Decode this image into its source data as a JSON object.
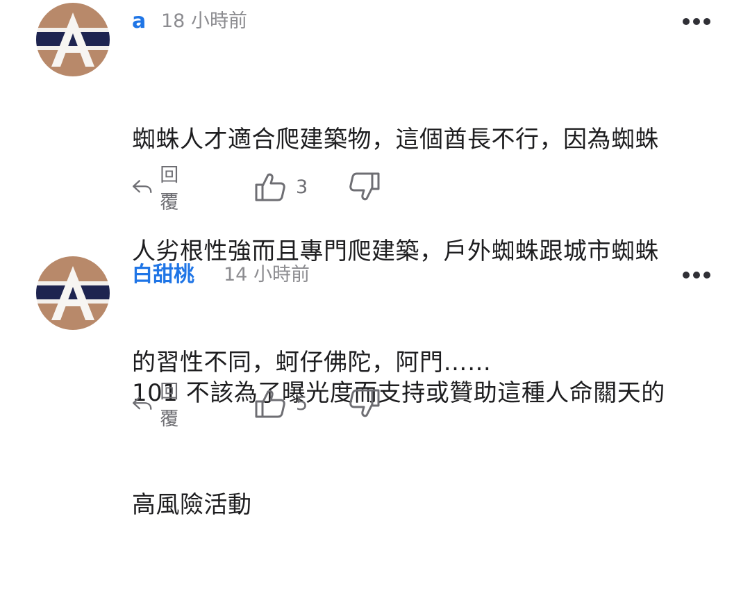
{
  "comments": [
    {
      "username": "a",
      "timestamp": "18 小時前",
      "lines": [
        "蜘蛛人才適合爬建築物，這個酋長不行，因為蜘蛛",
        "人劣根性強而且專門爬建築，戶外蜘蛛跟城市蜘蛛",
        "的習性不同，蚵仔佛陀，阿門……"
      ],
      "reply_label": "回覆",
      "like_count": "3",
      "avatar_letter": "A",
      "more_icon": "more-horizontal-icon",
      "reply_icon": "reply-arrow-icon",
      "like_icon": "thumbs-up-icon",
      "dislike_icon": "thumbs-down-icon"
    },
    {
      "username": "白甜桃",
      "timestamp": "14 小時前",
      "lines": [
        "101 不該為了曝光度而支持或贊助這種人命關天的",
        "高風險活動"
      ],
      "reply_label": "回覆",
      "like_count": "5",
      "avatar_letter": "A",
      "more_icon": "more-horizontal-icon",
      "reply_icon": "reply-arrow-icon",
      "like_icon": "thumbs-up-icon",
      "dislike_icon": "thumbs-down-icon"
    }
  ],
  "colors": {
    "username": "#1f75e6",
    "meta": "#8c8c90",
    "text": "#1d1d1f",
    "icon": "#6e6e73"
  }
}
